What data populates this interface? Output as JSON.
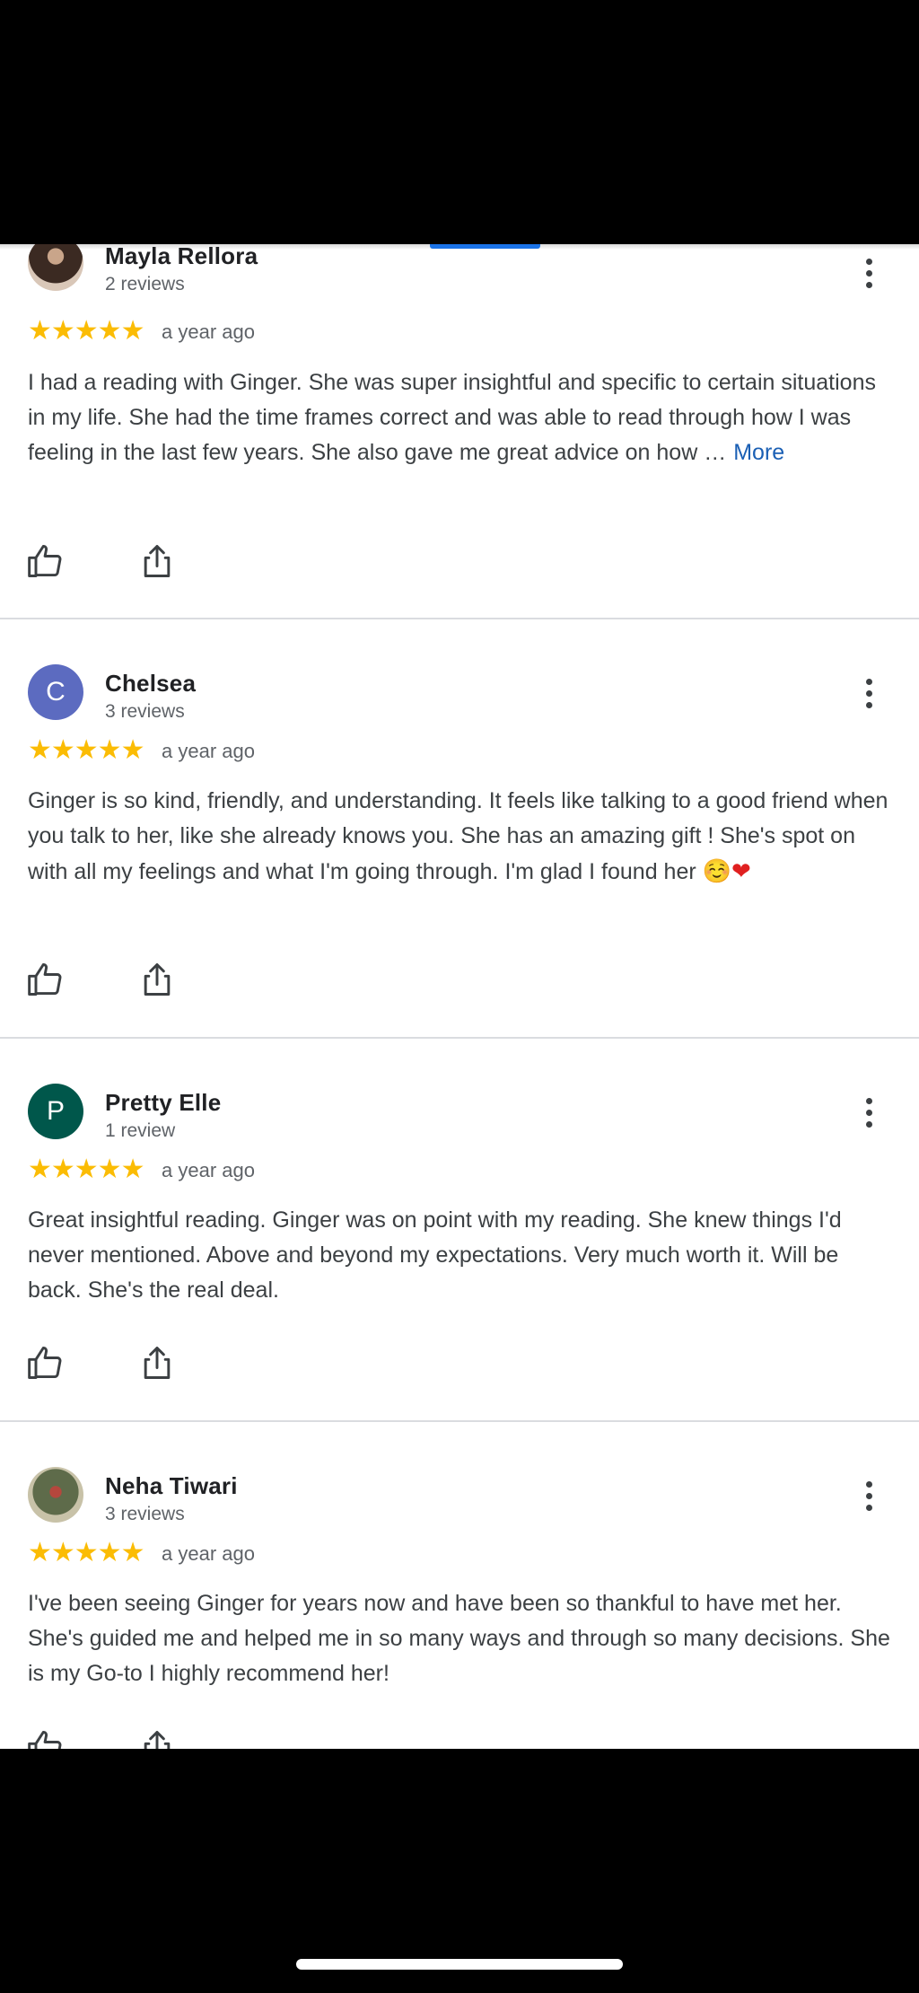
{
  "reviews": [
    {
      "name": "Mayla Rellora",
      "count": "2 reviews",
      "avatar_letter": "",
      "avatar_color": "#3b2a22",
      "date": "a year ago",
      "rating": "★★★★★",
      "text": "I had a reading with Ginger. She was super insightful and specific to certain situations in my life. She had the time frames correct and was able to read through how I was feeling in the last few years. She also gave me great advice on how …",
      "more_label": "More"
    },
    {
      "name": "Chelsea",
      "count": "3 reviews",
      "avatar_letter": "C",
      "avatar_color": "#5c6bc0",
      "date": "a year ago",
      "rating": "★★★★★",
      "text": "Ginger is so kind, friendly, and understanding. It feels like talking to a good friend when you talk to her, like she already knows you. She has an amazing gift ! She's spot on with all my feelings and what I'm going through. I'm glad I found her",
      "emoji_1": "☺️",
      "emoji_2": "❤"
    },
    {
      "name": "Pretty Elle",
      "count": "1 review",
      "avatar_letter": "P",
      "avatar_color": "#00574b",
      "date": "a year ago",
      "rating": "★★★★★",
      "text": "Great insightful reading. Ginger was on point with my reading. She knew things I'd never mentioned. Above and beyond my expectations. Very much worth it. Will be back. She's the real deal."
    },
    {
      "name": "Neha Tiwari",
      "count": "3 reviews",
      "avatar_letter": "",
      "avatar_color": "#5e6b4a",
      "date": "a year ago",
      "rating": "★★★★★",
      "text": "I've been seeing Ginger for years now and have been so thankful to have met her. She's guided me and helped me in so many ways and through so many decisions. She is my Go-to I highly recommend her!"
    }
  ],
  "icons": {
    "like": "thumb-up-icon",
    "share": "share-icon",
    "menu": "more-vert-icon"
  },
  "colors": {
    "star": "#fbbc04",
    "link": "#1a5fb4",
    "tab_indicator": "#1a73e8"
  }
}
